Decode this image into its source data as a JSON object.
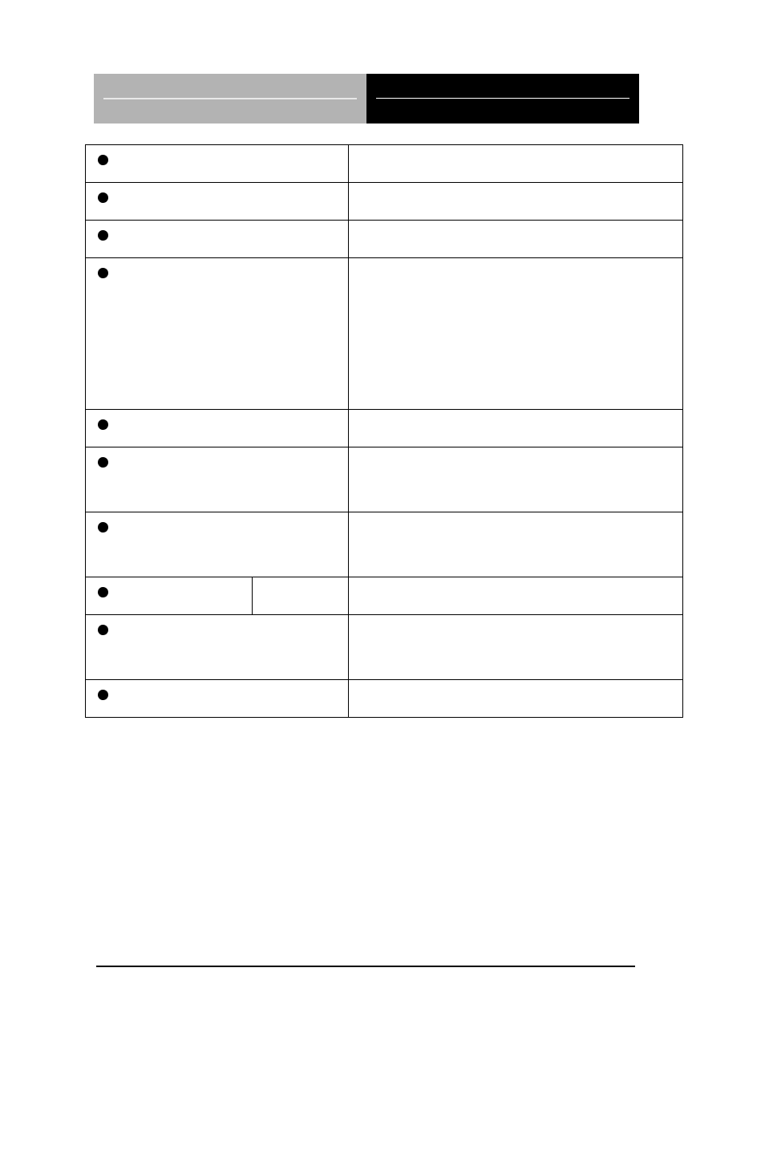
{
  "header": {
    "left_text": "",
    "right_text": ""
  },
  "table_rows": [
    {
      "height_class": "row-h1",
      "split_left": false,
      "left": "",
      "left_b": "",
      "right": ""
    },
    {
      "height_class": "row-h2",
      "split_left": false,
      "left": "",
      "left_b": "",
      "right": ""
    },
    {
      "height_class": "row-h3",
      "split_left": false,
      "left": "",
      "left_b": "",
      "right": ""
    },
    {
      "height_class": "row-h4",
      "split_left": false,
      "left": "",
      "left_b": "",
      "right": ""
    },
    {
      "height_class": "row-h5",
      "split_left": false,
      "left": "",
      "left_b": "",
      "right": ""
    },
    {
      "height_class": "row-h6",
      "split_left": false,
      "left": "",
      "left_b": "",
      "right": ""
    },
    {
      "height_class": "row-h7",
      "split_left": false,
      "left": "",
      "left_b": "",
      "right": ""
    },
    {
      "height_class": "row-h8",
      "split_left": true,
      "left": "",
      "left_b": "",
      "right": ""
    },
    {
      "height_class": "row-h9",
      "split_left": false,
      "left": "",
      "left_b": "",
      "right": ""
    },
    {
      "height_class": "row-h10",
      "split_left": false,
      "left": "",
      "left_b": "",
      "right": ""
    }
  ]
}
